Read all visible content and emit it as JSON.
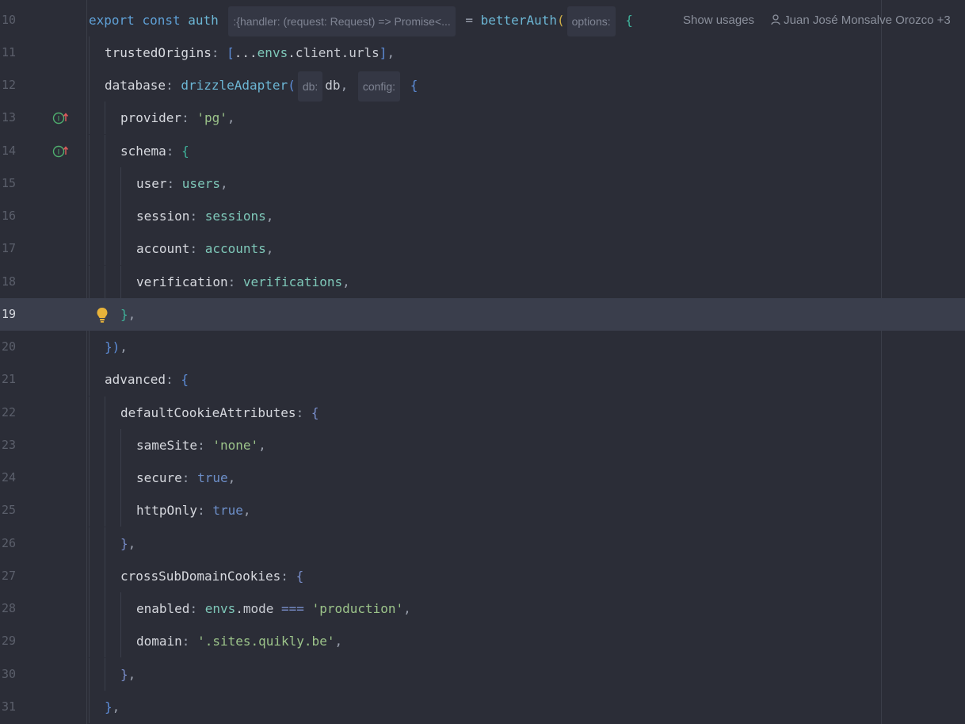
{
  "line10": {
    "number": "10",
    "kw_export": "export",
    "kw_const": "const",
    "name": "auth",
    "type_hint": ":{handler: (request: Request) => Promise<...",
    "equals": " = ",
    "fn": "betterAuth",
    "open_paren": "(",
    "param_hint": "options:",
    "open_brace": " {",
    "show_usages": "Show usages",
    "author": "Juan José Monsalve Orozco +3"
  },
  "lines": [
    {
      "number": "11"
    },
    {
      "number": "12"
    },
    {
      "number": "13"
    },
    {
      "number": "14"
    },
    {
      "number": "15"
    },
    {
      "number": "16"
    },
    {
      "number": "17"
    },
    {
      "number": "18"
    },
    {
      "number": "19"
    },
    {
      "number": "20"
    },
    {
      "number": "21"
    },
    {
      "number": "22"
    },
    {
      "number": "23"
    },
    {
      "number": "24"
    },
    {
      "number": "25"
    },
    {
      "number": "26"
    },
    {
      "number": "27"
    },
    {
      "number": "28"
    },
    {
      "number": "29"
    },
    {
      "number": "30"
    },
    {
      "number": "31"
    }
  ],
  "code": {
    "l11_key": "trustedOrigins",
    "l11_colon": ": ",
    "l11_ob": "[",
    "l11_spread": "...",
    "l11_envs": "envs",
    "l11_rest": ".client.urls",
    "l11_cb": "]",
    "l11_comma": ",",
    "l12_key": "database",
    "l12_colon": ": ",
    "l12_fn": "drizzleAdapter",
    "l12_op": "(",
    "l12_hint_db": "db:",
    "l12_db": "db",
    "l12_comma": ", ",
    "l12_hint_config": "config:",
    "l12_ob": " {",
    "l13_key": "provider",
    "l13_colon": ": ",
    "l13_val": "'pg'",
    "l13_comma": ",",
    "l14_key": "schema",
    "l14_colon": ": ",
    "l14_ob": "{",
    "l15_key": "user",
    "l15_colon": ": ",
    "l15_val": "users",
    "l15_comma": ",",
    "l16_key": "session",
    "l16_colon": ": ",
    "l16_val": "sessions",
    "l16_comma": ",",
    "l17_key": "account",
    "l17_colon": ": ",
    "l17_val": "accounts",
    "l17_comma": ",",
    "l18_key": "verification",
    "l18_colon": ": ",
    "l18_val": "verifications",
    "l18_comma": ",",
    "l19_cb": "}",
    "l19_comma": ",",
    "l20_cb": "}",
    "l20_cp": ")",
    "l20_comma": ",",
    "l21_key": "advanced",
    "l21_colon": ": ",
    "l21_ob": "{",
    "l22_key": "defaultCookieAttributes",
    "l22_colon": ": ",
    "l22_ob": "{",
    "l23_key": "sameSite",
    "l23_colon": ": ",
    "l23_val": "'none'",
    "l23_comma": ",",
    "l24_key": "secure",
    "l24_colon": ": ",
    "l24_val": "true",
    "l24_comma": ",",
    "l25_key": "httpOnly",
    "l25_colon": ": ",
    "l25_val": "true",
    "l25_comma": ",",
    "l26_cb": "}",
    "l26_comma": ",",
    "l27_key": "crossSubDomainCookies",
    "l27_colon": ": ",
    "l27_ob": "{",
    "l28_key": "enabled",
    "l28_colon": ": ",
    "l28_envs": "envs",
    "l28_mode": ".mode",
    "l28_op": " === ",
    "l28_val": "'production'",
    "l28_comma": ",",
    "l29_key": "domain",
    "l29_colon": ": ",
    "l29_val": "'.sites.quikly.be'",
    "l29_comma": ",",
    "l30_cb": "}",
    "l30_comma": ",",
    "l31_cb": "}",
    "l31_comma": ","
  },
  "colors": {
    "background": "#2b2d37",
    "current_line": "#3a3e4c",
    "keyword": "#5fa0d6",
    "string": "#9cc48a",
    "function": "#6cb6d4"
  },
  "icons": {
    "gutter_13": "implementation-up-arrow-icon",
    "gutter_14": "implementation-up-arrow-icon",
    "line_19": "lightbulb-icon",
    "author": "user-icon"
  }
}
